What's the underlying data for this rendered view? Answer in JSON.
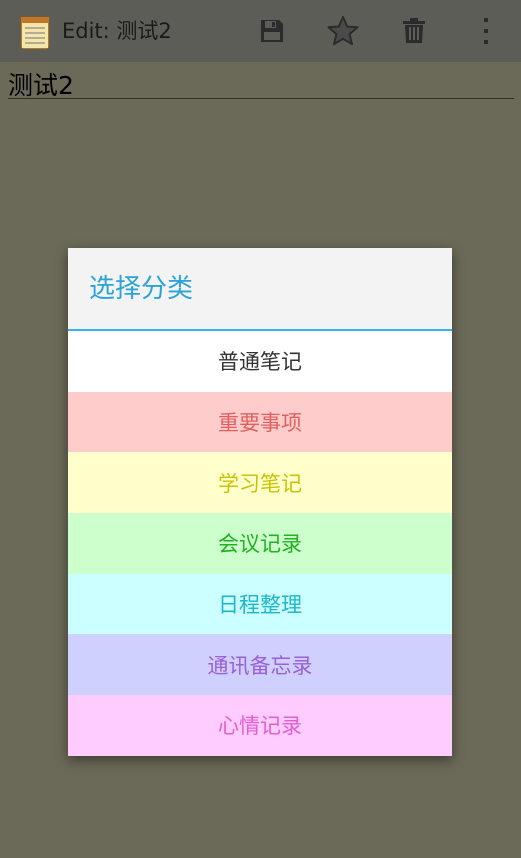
{
  "action_bar": {
    "title": "Edit: 测试2",
    "icons": [
      "notepad-app-icon",
      "save-icon",
      "star-icon",
      "trash-icon",
      "overflow-menu-icon"
    ]
  },
  "note": {
    "text": "测试2"
  },
  "dialog": {
    "title": "选择分类",
    "accent_color": "#33b5e5",
    "options": [
      {
        "label": "普通笔记",
        "bg": "#ffffff",
        "color": "#333333"
      },
      {
        "label": "重要事项",
        "bg": "#ffcccc",
        "color": "#e06060"
      },
      {
        "label": "学习笔记",
        "bg": "#ffffcc",
        "color": "#c9c300"
      },
      {
        "label": "会议记录",
        "bg": "#ccffcc",
        "color": "#22b022"
      },
      {
        "label": "日程整理",
        "bg": "#ccffff",
        "color": "#1fb6c6"
      },
      {
        "label": "通讯备忘录",
        "bg": "#d0d0ff",
        "color": "#9b5fd6"
      },
      {
        "label": "心情记录",
        "bg": "#ffccff",
        "color": "#e060d0"
      }
    ]
  }
}
